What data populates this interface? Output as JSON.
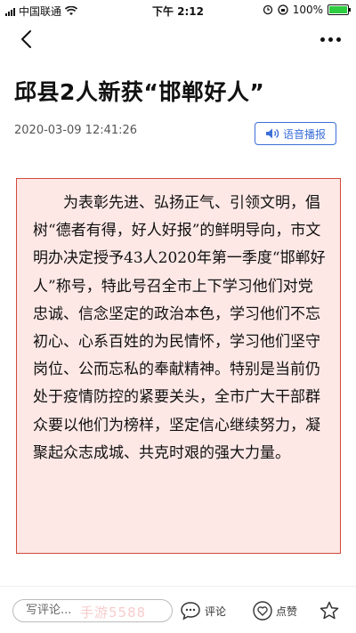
{
  "status_bar": {
    "carrier": "中国联通",
    "time": "下午 2:12",
    "battery": "100%",
    "battery_level": 1.0
  },
  "article": {
    "title": "邱县2人新获“邯郸好人”",
    "date": "2020-03-09 12:41:26",
    "voice_label": "语音播报",
    "body": "为表彰先进、弘扬正气、引领文明，倡树“德者有得，好人好报”的鲜明导向，市文明办决定授予43人2020年第一季度“邯郸好人”称号，特此号召全市上下学习他们对党忠诚、信念坚定的政治本色，学习他们不忘初心、心系百姓的为民情怀，学习他们坚守岗位、公而忘私的奉献精神。特别是当前仍处于疫情防控的紧要关头，全市广大干部群众要以他们为榜样，坚定信心继续努力，凝聚起众志成城、共克时艰的强大力量。"
  },
  "bottom_bar": {
    "comment_placeholder": "写评论...",
    "comment_label": "评论",
    "like_label": "点赞"
  },
  "watermark": "手游5588",
  "icons": {
    "back": "chevron-left-icon",
    "more": "more-dots-icon",
    "speaker": "speaker-icon",
    "comment": "chat-bubble-icon",
    "like": "heart-icon",
    "favorite": "star-icon",
    "wifi": "wifi-icon",
    "battery": "battery-icon"
  },
  "colors": {
    "accent_blue": "#3c6fd9",
    "box_border": "#d04a3c",
    "box_background": "#fde8e6"
  }
}
